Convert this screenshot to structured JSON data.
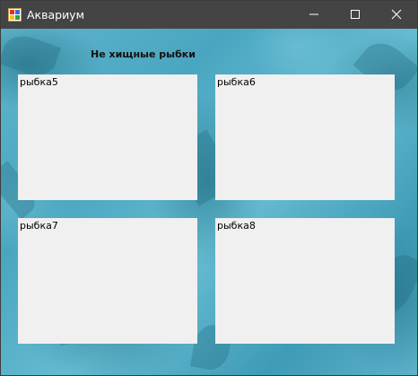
{
  "window": {
    "title": "Аквариум",
    "icon": "app-form-icon",
    "controls": {
      "minimize_icon": "minimize-icon",
      "maximize_icon": "maximize-icon",
      "close_icon": "close-icon"
    }
  },
  "main": {
    "header": "Не хищные рыбки",
    "boxes": [
      {
        "label": "рыбка5"
      },
      {
        "label": "рыбка6"
      },
      {
        "label": "рыбка7"
      },
      {
        "label": "рыбка8"
      }
    ]
  },
  "colors": {
    "titlebar": "#444444",
    "water": "#5fb4cc",
    "box": "#f0f0f0"
  }
}
